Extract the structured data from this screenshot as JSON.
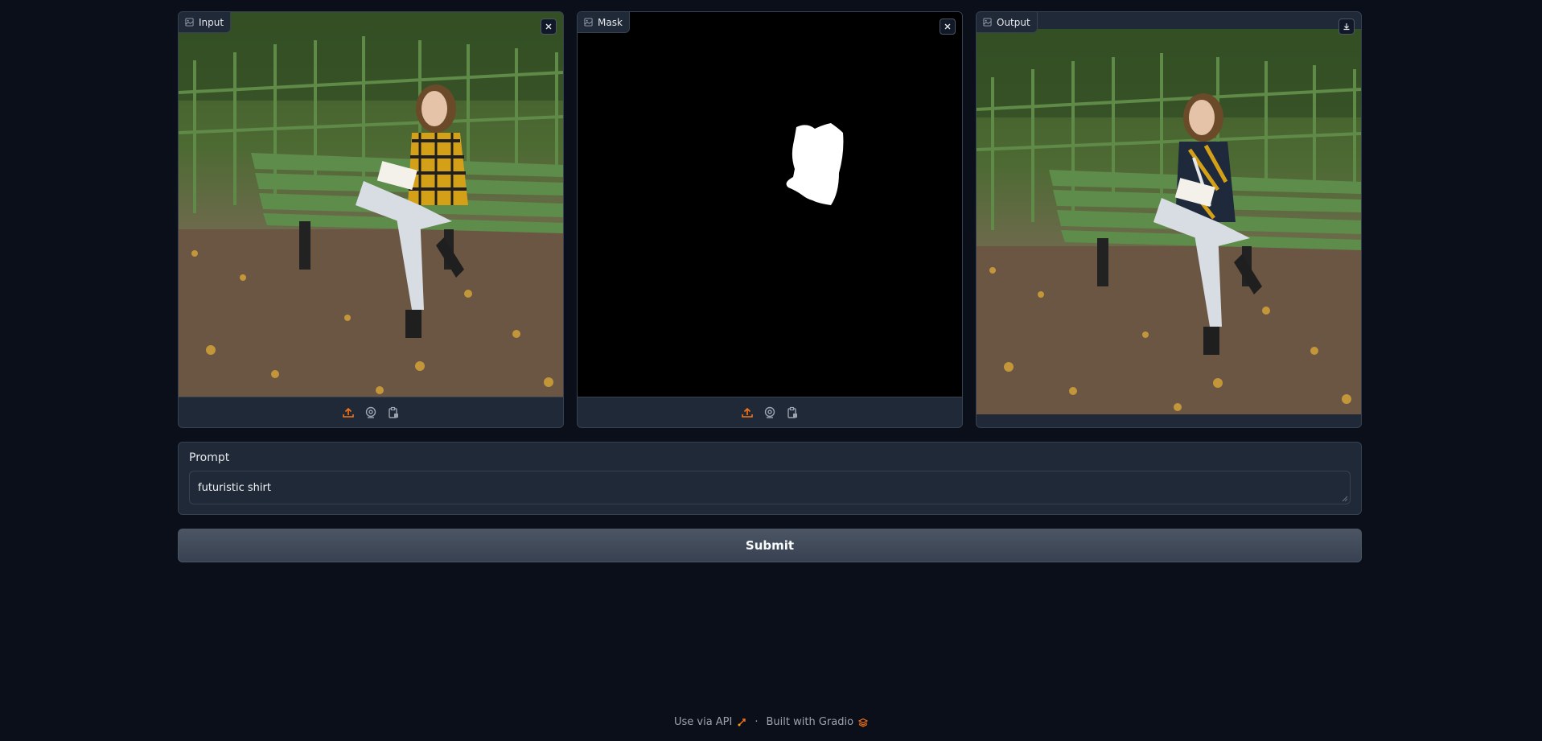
{
  "panels": {
    "input": {
      "label": "Input",
      "icon": "image-icon",
      "corner_icon": "close-icon"
    },
    "mask": {
      "label": "Mask",
      "icon": "image-icon",
      "corner_icon": "close-icon"
    },
    "output": {
      "label": "Output",
      "icon": "image-icon",
      "corner_icon": "download-icon"
    }
  },
  "toolbar_icons": [
    "upload-icon",
    "webcam-icon",
    "clipboard-icon"
  ],
  "prompt": {
    "label": "Prompt",
    "value": "futuristic shirt"
  },
  "submit": {
    "label": "Submit"
  },
  "footer": {
    "api_label": "Use via API",
    "separator": "·",
    "gradio_label": "Built with Gradio"
  },
  "colors": {
    "background": "#0b0f19",
    "panel": "#1f2937",
    "border": "#374151",
    "accent": "#f97316"
  }
}
